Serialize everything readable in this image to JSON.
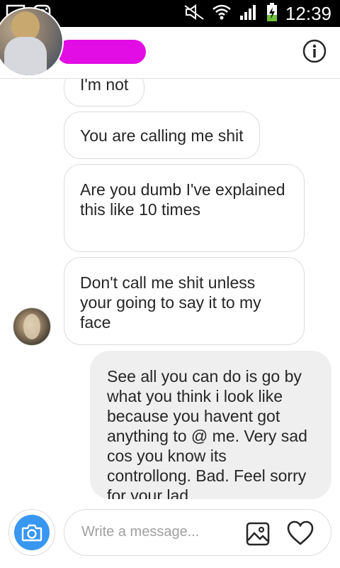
{
  "status_bar": {
    "time": "12:39",
    "icons": [
      "gallery-icon",
      "instagram-icon",
      "mute-icon",
      "wifi-icon",
      "signal-icon",
      "battery-charging-icon"
    ]
  },
  "header": {
    "info_icon": "info-icon"
  },
  "messages": [
    {
      "direction": "incoming",
      "text": "I'm not"
    },
    {
      "direction": "incoming",
      "text": "You are calling me shit"
    },
    {
      "direction": "incoming",
      "text": "Are you dumb I've explained this like 10 times"
    },
    {
      "direction": "incoming",
      "text": "Don't call me shit unless your going to say it to my face"
    },
    {
      "direction": "outgoing",
      "text": "See all you can do is go by what you think i look like because you havent got anything to @ me. Very sad cos you know its controllong. Bad. Feel sorry for your lad."
    }
  ],
  "composer": {
    "placeholder": "Write a message...",
    "camera_icon": "camera-icon",
    "gallery_icon": "image-icon",
    "heart_icon": "heart-icon",
    "accent": "#3897f0"
  },
  "colors": {
    "redaction": "#e20ce4",
    "outgoing_bubble": "#efefef",
    "bubble_border": "#dcdcdc"
  }
}
